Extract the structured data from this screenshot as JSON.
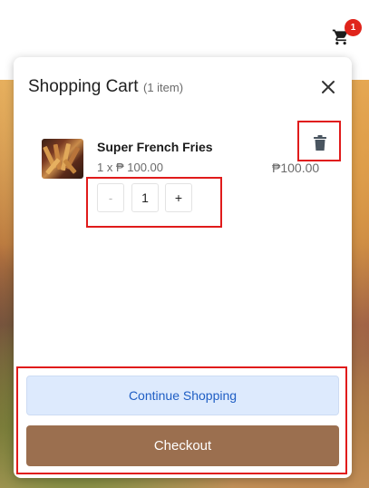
{
  "header": {
    "cart_badge": "1",
    "cart_icon": "shopping-cart-icon"
  },
  "cart": {
    "title": "Shopping Cart",
    "count_label": "(1 item)",
    "close_icon": "close-icon",
    "items": [
      {
        "name": "Super French Fries",
        "unit_line": "1 x ₱ 100.00",
        "total": "₱100.00",
        "thumbnail": "french-fries-image",
        "quantity": "1",
        "minus_label": "-",
        "plus_label": "+"
      }
    ],
    "continue_label": "Continue Shopping",
    "checkout_label": "Checkout"
  },
  "colors": {
    "badge": "#e0241b",
    "continue_bg": "#ddeafd",
    "continue_text": "#1f5ec4",
    "checkout_bg": "#9b6f4f",
    "highlight": "#e01b1b"
  }
}
